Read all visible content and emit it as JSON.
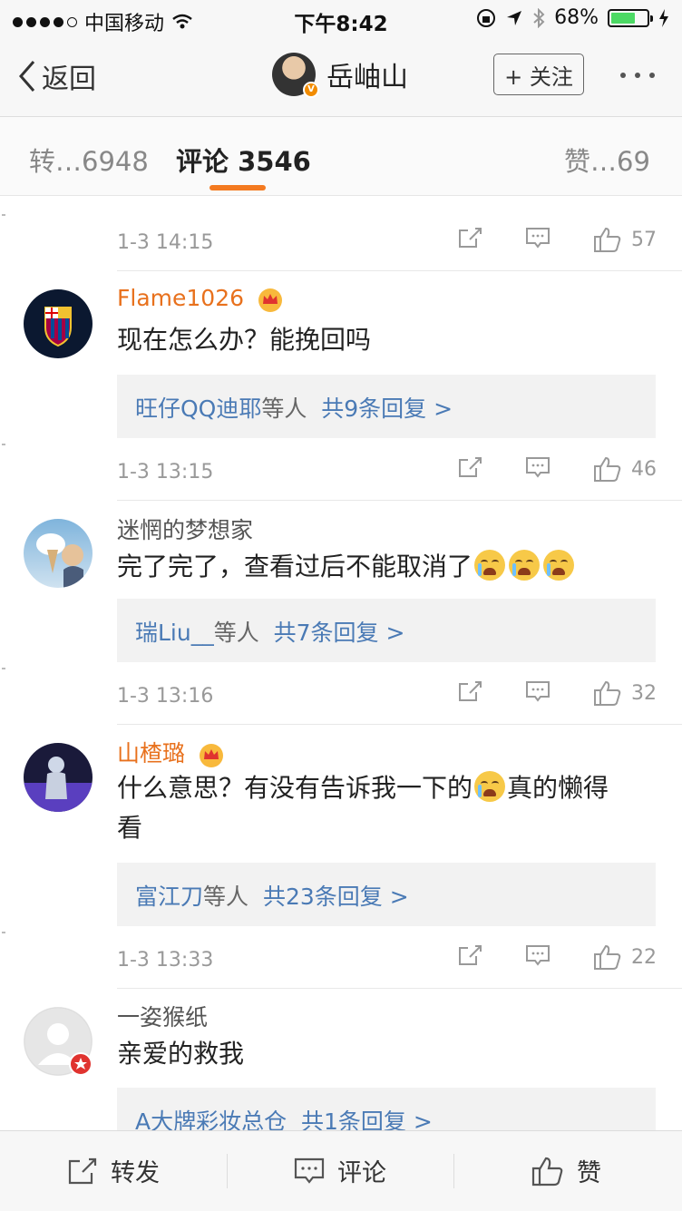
{
  "status_bar": {
    "carrier": "中国移动",
    "time": "下午8:42",
    "battery_pct": "68%",
    "battery_level": 0.68
  },
  "nav": {
    "back_label": "返回",
    "user_name": "岳岫山",
    "follow_label": "+ 关注"
  },
  "tabs": {
    "repost": "转…6948",
    "comment_label": "评论",
    "comment_count": "3546",
    "like": "赞…69"
  },
  "comments": [
    {
      "date": "1-3 14:15",
      "likes": "57"
    },
    {
      "user": "Flame1026",
      "text": "现在怎么办？能挽回吗",
      "reply_who": "旺仔QQ迪耶",
      "reply_plain": "等人",
      "reply_count": "共9条回复 >",
      "date": "1-3 13:15",
      "likes": "46"
    },
    {
      "user": "迷惘的梦想家",
      "text": "完了完了，查看过后不能取消了",
      "reply_who": "瑞Liu__",
      "reply_plain": "等人",
      "reply_count": "共7条回复 >",
      "date": "1-3 13:16",
      "likes": "32"
    },
    {
      "user": "山楂璐",
      "text_a": "什么意思？有没有告诉我一下的",
      "text_b": "真的懒得",
      "text_c": "看",
      "reply_who": "富江刀",
      "reply_plain": "等人",
      "reply_count": "共23条回复 >",
      "date": "1-3 13:33",
      "likes": "22"
    },
    {
      "user": "一姿猴纸",
      "text": "亲爱的救我",
      "reply_who": "A大牌彩妆总仓",
      "reply_count": "共1条回复 >"
    }
  ],
  "bottom_bar": {
    "repost": "转发",
    "comment": "评论",
    "like": "赞"
  },
  "colors": {
    "accent": "#f47a20",
    "vip_name": "#e8711d",
    "link": "#4a7ab5"
  }
}
